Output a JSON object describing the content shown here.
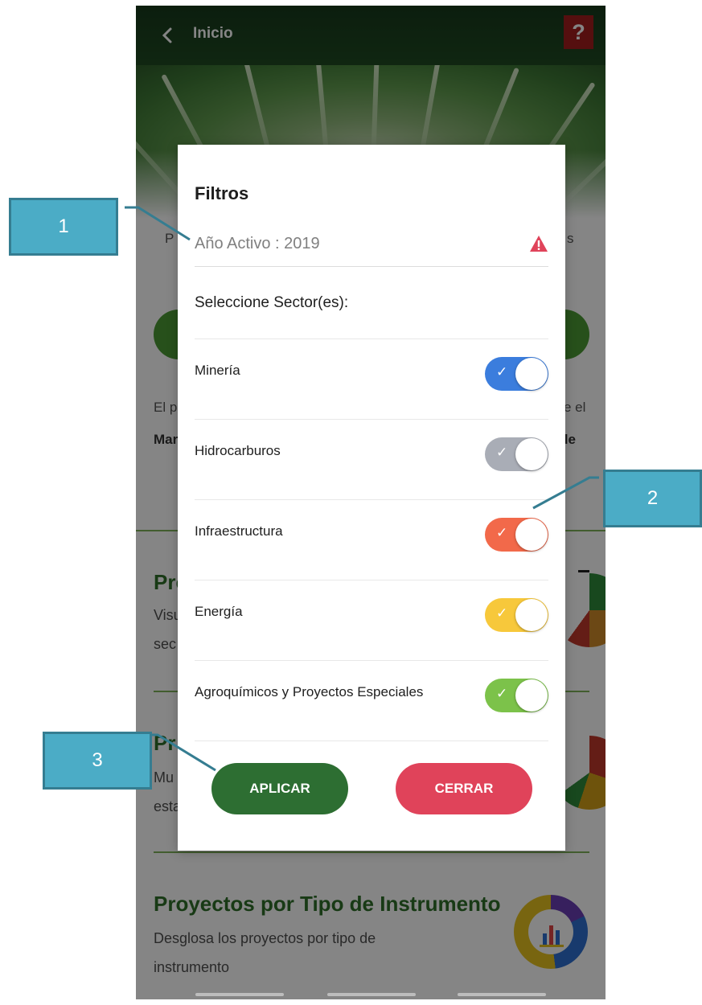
{
  "appbar": {
    "title": "Inicio",
    "help_label": "?"
  },
  "background": {
    "partial_left_1": "P",
    "partial_right_1": "s",
    "partial_left_2": "El p",
    "partial_right_2": "e el",
    "partial_left_3": "Mar",
    "partial_right_3": "o de",
    "section1_title_partial": "Pro",
    "section1_desc_partial_1": "Visu",
    "section1_desc_partial_2": "sec",
    "section2_title_partial": "Pr",
    "section2_desc_partial_1": "Mu",
    "section2_desc_partial_2": "esta",
    "section3_title": "Proyectos por Tipo de Instrumento",
    "section3_desc_1": "Desglosa los proyectos por tipo de",
    "section3_desc_2": "instrumento"
  },
  "dialog": {
    "title": "Filtros",
    "year_label": "Año Activo : 2019",
    "sector_prompt": "Seleccione Sector(es):",
    "sectors": [
      {
        "label": "Minería",
        "color": "#3b7ddd",
        "on": true
      },
      {
        "label": "Hidrocarburos",
        "color": "#a9adb6",
        "on": true
      },
      {
        "label": "Infraestructura",
        "color": "#f2694a",
        "on": true
      },
      {
        "label": "Energía",
        "color": "#f7c83b",
        "on": true
      },
      {
        "label": "Agroquímicos y Proyectos Especiales",
        "color": "#7cc24a",
        "on": true
      }
    ],
    "apply_label": "APLICAR",
    "close_label": "CERRAR",
    "check_glyph": "✓"
  },
  "callouts": {
    "c1": "1",
    "c2": "2",
    "c3": "3"
  },
  "colors": {
    "warning": "#e0435a",
    "callout_fill": "#4bacc6",
    "apply": "#2d6e32",
    "close": "#e0435a"
  }
}
